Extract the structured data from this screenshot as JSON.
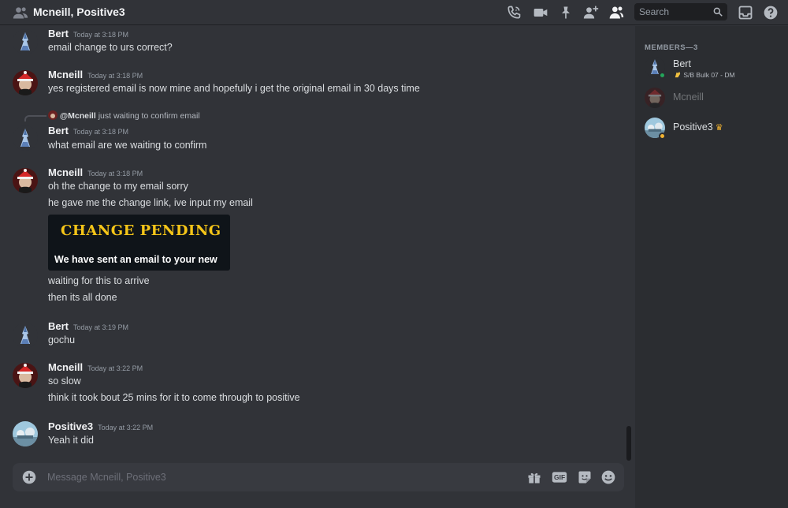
{
  "header": {
    "title": "Mcneill, Positive3",
    "search_placeholder": "Search"
  },
  "messages": [
    {
      "id": "m1",
      "author": "Bert",
      "timestamp": "Today at 3:18 PM",
      "lines": [
        "email change to urs correct?"
      ]
    },
    {
      "id": "m2",
      "author": "Mcneill",
      "timestamp": "Today at 3:18 PM",
      "lines": [
        "yes registered email is now mine and hopefully i get the original email in 30 days time"
      ]
    },
    {
      "id": "m3",
      "author": "Bert",
      "timestamp": "Today at 3:18 PM",
      "reply": {
        "mention": "@Mcneill",
        "text": "just waiting to confirm email"
      },
      "lines": [
        "what email are we waiting to confirm"
      ]
    },
    {
      "id": "m4",
      "author": "Mcneill",
      "timestamp": "Today at 3:18 PM",
      "lines": [
        "oh the change to my email sorry",
        "he gave me the change link, ive input my email"
      ],
      "image": {
        "heading": "CHANGE PENDING",
        "subtext": "We have sent an email to your new"
      },
      "lines_after": [
        "waiting for this to arrive",
        "then its all done"
      ]
    },
    {
      "id": "m5",
      "author": "Bert",
      "timestamp": "Today at 3:19 PM",
      "lines": [
        "gochu"
      ]
    },
    {
      "id": "m6",
      "author": "Mcneill",
      "timestamp": "Today at 3:22 PM",
      "lines": [
        "so slow",
        "think it took bout 25 mins for it to come through to positive"
      ]
    },
    {
      "id": "m7",
      "author": "Positive3",
      "timestamp": "Today at 3:22 PM",
      "lines": [
        "Yeah it did"
      ]
    }
  ],
  "composer": {
    "placeholder": "Message Mcneill, Positive3",
    "gif_label": "GIF"
  },
  "members": {
    "heading": "MEMBERS—3",
    "list": [
      {
        "name": "Bert",
        "status_text": "S/B Bulk 07 - DM",
        "presence": "online"
      },
      {
        "name": "Mcneill",
        "status_text": "",
        "presence": "offline"
      },
      {
        "name": "Positive3",
        "status_text": "",
        "presence": "idle",
        "owner": true
      }
    ]
  },
  "colors": {
    "background": "#313338",
    "sidebar": "#2b2d31",
    "online": "#23a55a",
    "idle": "#f0b232",
    "embed_heading": "#f5c518"
  }
}
